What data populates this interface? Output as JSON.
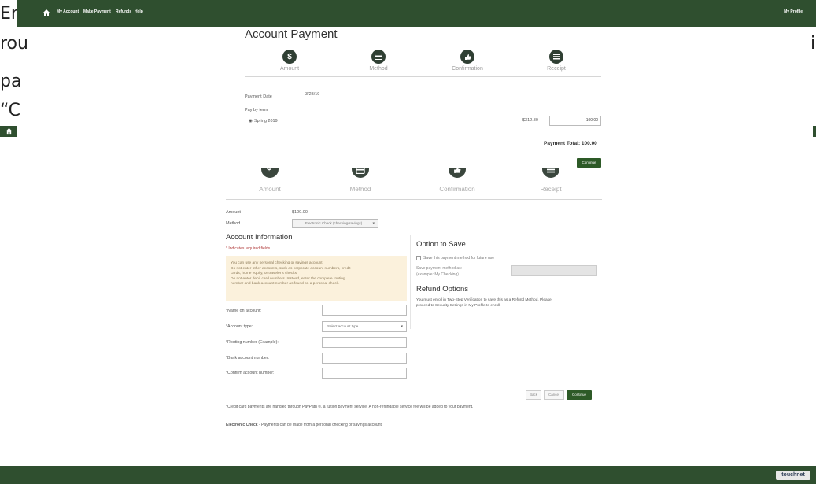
{
  "background_doc": {
    "line1": "En",
    "line2": "rou",
    "line2_right": "i",
    "line3": "pa",
    "line4": "“C"
  },
  "topnav": {
    "items": [
      "My Account",
      "Make Payment",
      "Refunds",
      "Help"
    ],
    "profile": "My Profile"
  },
  "panel1": {
    "title": "Account Payment",
    "steps": [
      "Amount",
      "Method",
      "Confirmation",
      "Receipt"
    ],
    "payment_date_label": "Payment Date",
    "payment_date_value": "3/28/19",
    "pay_by_term_label": "Pay by term",
    "term": "Spring 2019",
    "term_amount": "$312.80",
    "amount_input_value": "100.00",
    "payment_total": "Payment Total: 100.00",
    "continue_label": "Continue"
  },
  "panel2": {
    "steps": [
      "Amount",
      "Method",
      "Confirmation",
      "Receipt"
    ],
    "amount_label": "Amount",
    "amount_value": "$100.00",
    "method_label": "Method",
    "method_value": "Electronic Check (checking/savings)",
    "account_info_title": "Account Information",
    "required_note": "* Indicates required fields",
    "notice": [
      "You can use any personal checking or savings account.",
      "Do not enter other accounts, such as corporate account numbers, credit",
      "cards, home equity, or traveler's checks.",
      "Do not enter debit card numbers. Instead, enter the complete routing",
      "number and bank account number as found on a personal check."
    ],
    "fields": [
      {
        "label": "*Name on account:",
        "value": ""
      },
      {
        "label": "*Account type:",
        "value": "Select account type"
      },
      {
        "label": "*Routing number (Example):",
        "value": ""
      },
      {
        "label": "*Bank account number:",
        "value": ""
      },
      {
        "label": "*Confirm account number:",
        "value": ""
      }
    ],
    "option_to_save_title": "Option to Save",
    "save_checkbox_label": "Save this payment method for future use",
    "save_as_label_1": "Save payment method as:",
    "save_as_label_2": "(example: My Checking)",
    "refund_title": "Refund Options",
    "refund_text_1": "You must enroll in Two-Step Verification to save this as a Refund Method. Please",
    "refund_text_2": "proceed to Security Settings in My Profile to enroll.",
    "back_label": "Back",
    "cancel_label": "Cancel",
    "continue_label": "Continue",
    "credit_note": "*Credit card payments are handled through PayPath ®, a tuition payment service. A non-refundable service fee will be added to your payment.",
    "echeck_bold": "Electronic Check",
    "echeck_text": " - Payments can be made from a personal checking or savings account."
  },
  "footer": {
    "brand": "touchnet"
  },
  "colors": {
    "nav_green": "#2f4f2f",
    "button_green": "#2d5a27"
  }
}
